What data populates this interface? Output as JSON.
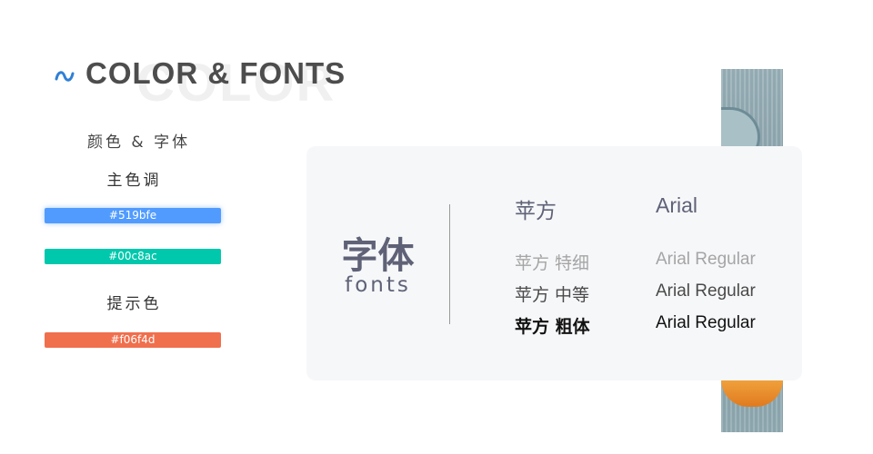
{
  "header": {
    "title": "COLOR & FONTS",
    "ghost_word": "COLOR",
    "subtitle": "颜色 & 字体",
    "icon": "swirl-icon"
  },
  "colors": {
    "primary_label": "主色调",
    "hint_label": "提示色",
    "swatches": [
      {
        "hex": "#519bfe",
        "label": "#519bfe"
      },
      {
        "hex": "#00c8ac",
        "label": "#00c8ac"
      },
      {
        "hex": "#f06f4d",
        "label": "#f06f4d"
      }
    ]
  },
  "fonts_card": {
    "big_title": "字体",
    "big_subtitle": "fonts",
    "columns": [
      {
        "heading": "苹方",
        "samples": [
          "苹方 特细",
          "苹方 中等",
          "苹方 粗体"
        ]
      },
      {
        "heading": "Arial",
        "samples": [
          "Arial Regular",
          "Arial Regular",
          "Arial Regular"
        ]
      }
    ]
  },
  "theme": {
    "title_color": "#4d4d4d",
    "card_bg": "#f6f7f9",
    "card_text": "#5f6277",
    "icon_color": "#2f7fd6"
  }
}
